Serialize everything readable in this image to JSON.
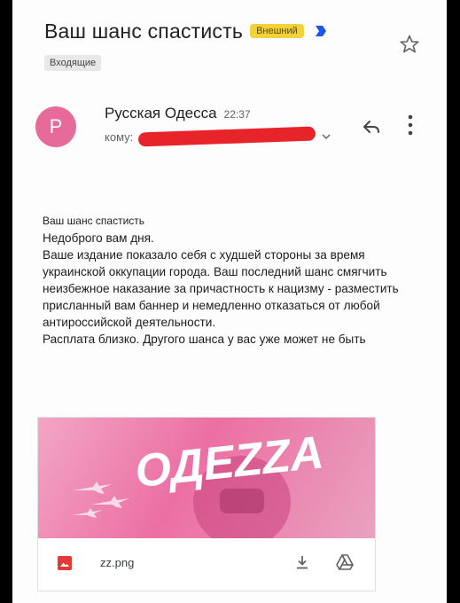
{
  "email": {
    "subject": "Ваш шанс спастисть",
    "external_badge": "Внешний",
    "label": "Входящие",
    "sender": {
      "initial": "P",
      "name": "Русская Одесса",
      "time": "22:37",
      "to_label": "кому:"
    },
    "body_lines": [
      "Ваш шанс спастисть",
      "Недоброго вам дня.",
      "Ваше издание показало себя с худшей стороны за время украинской оккупации города. Ваш последний шанс смягчить неизбежное наказание за причастность к нацизму - разместить присланный вам баннер и немедленно отказаться от любой антироссийской деятельности.",
      "Расплата близко. Другого шанса у вас уже может не быть"
    ],
    "attachment": {
      "preview_text": "ОДЕZZА",
      "file_name": "zz.png"
    }
  },
  "icons": {
    "important": "important-marker-icon",
    "star": "star-icon",
    "reply": "reply-icon",
    "more": "more-vert-icon",
    "expand": "chevron-down-icon",
    "image_file": "image-file-icon",
    "download": "download-icon",
    "drive": "google-drive-icon"
  },
  "colors": {
    "avatar": "#e66a9a",
    "badge": "#f2d23a",
    "important_marker": "#1a56e8",
    "redaction": "#e8242b"
  }
}
